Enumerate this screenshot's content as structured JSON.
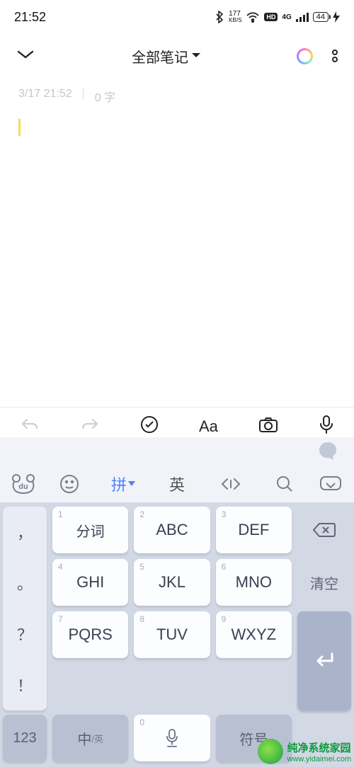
{
  "status": {
    "time": "21:52",
    "speed_num": "177",
    "speed_unit": "KB/S",
    "hd": "HD",
    "net": "4G",
    "battery": "44"
  },
  "header": {
    "title": "全部笔记"
  },
  "note": {
    "date": "3/17 21:52",
    "wc": "0 字"
  },
  "kbd_tabs": {
    "pin": "拼",
    "en": "英"
  },
  "keys": {
    "puncts": [
      "，",
      "。",
      "？",
      "！"
    ],
    "r1": [
      {
        "d": "1",
        "m": "分词"
      },
      {
        "d": "2",
        "m": "ABC"
      },
      {
        "d": "3",
        "m": "DEF"
      }
    ],
    "r2": [
      {
        "d": "4",
        "m": "GHI"
      },
      {
        "d": "5",
        "m": "JKL"
      },
      {
        "d": "6",
        "m": "MNO"
      }
    ],
    "r3": [
      {
        "d": "7",
        "m": "PQRS"
      },
      {
        "d": "8",
        "m": "TUV"
      },
      {
        "d": "9",
        "m": "WXYZ"
      }
    ],
    "clear": "清空",
    "bottom": {
      "num": "123",
      "lang": "中",
      "lang_sub": "/英",
      "space_d": "0",
      "sym": "符号"
    }
  },
  "watermark": {
    "brand": "纯净系统家园",
    "url": "www.yidaimei.com"
  }
}
